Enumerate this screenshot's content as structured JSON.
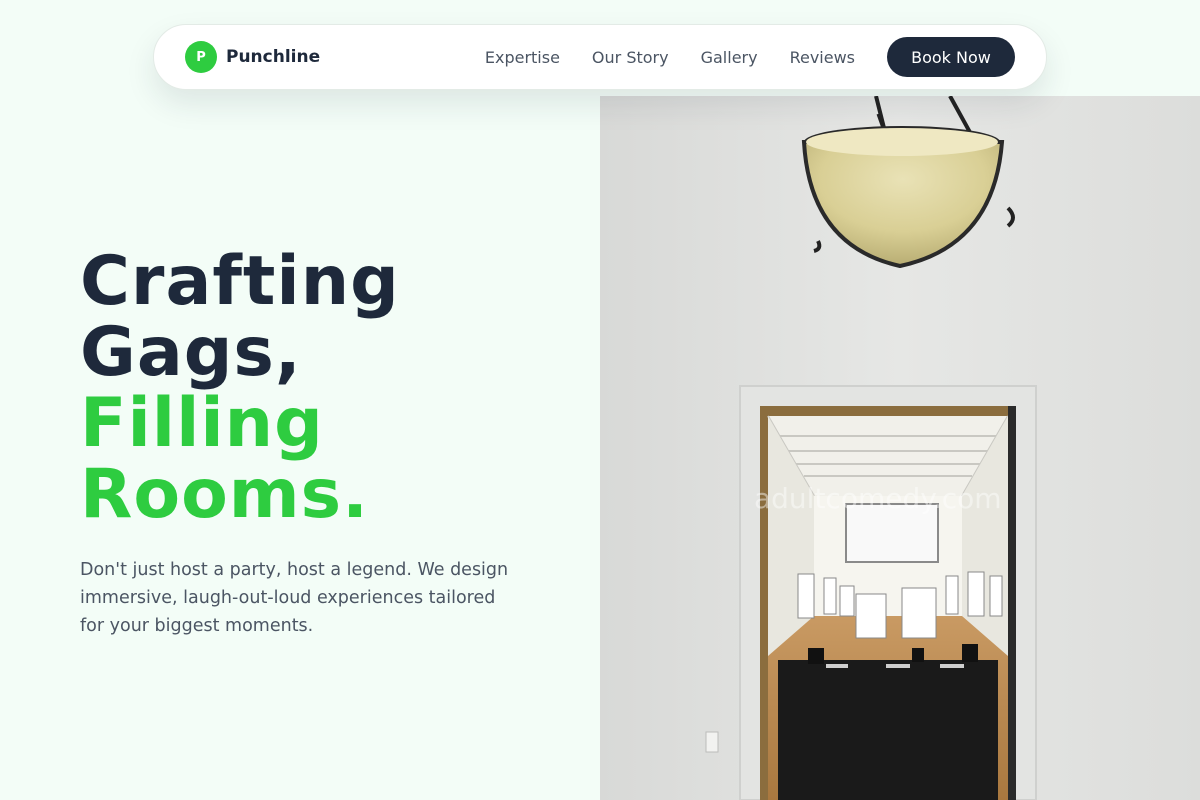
{
  "nav": {
    "brand_initial": "P",
    "brand_name": "Punchline",
    "links": [
      "Expertise",
      "Our Story",
      "Gallery",
      "Reviews"
    ],
    "cta": "Book Now"
  },
  "hero": {
    "headline_line1": "Crafting",
    "headline_line2": "Gags,",
    "headline_line3": "Filling",
    "headline_line4": "Rooms.",
    "subtext": "Don't just host a party, host a legend. We design immersive, laugh-out-loud experiences tailored for your biggest moments.",
    "image_watermark": "adultcomedy.com"
  },
  "colors": {
    "accent_green": "#2ecc40",
    "dark_navy": "#1e293b",
    "page_background": "#f3fdf7"
  }
}
